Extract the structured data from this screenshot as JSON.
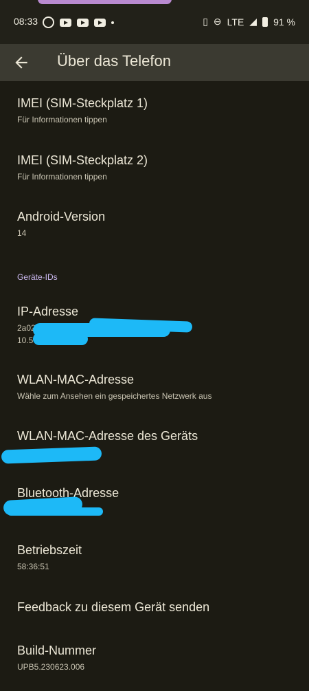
{
  "status_bar": {
    "time": "08:33",
    "network": "LTE",
    "battery": "91 %",
    "icons_left": [
      "whatsapp-icon",
      "youtube-icon",
      "youtube-icon",
      "youtube-icon",
      "dot-icon"
    ],
    "icons_right": [
      "vibrate-icon",
      "dnd-icon",
      "signal-icon",
      "battery-icon"
    ]
  },
  "app_bar": {
    "title": "Über das Telefon"
  },
  "items": [
    {
      "title": "IMEI (SIM-Steckplatz 1)",
      "subtitle": "Für Informationen tippen"
    },
    {
      "title": "IMEI (SIM-Steckplatz 2)",
      "subtitle": "Für Informationen tippen"
    },
    {
      "title": "Android-Version",
      "subtitle": "14"
    },
    {
      "section": "Geräte-IDs"
    },
    {
      "title": "IP-Adresse",
      "subtitle": "2a02",
      "subtitle2": "10.5"
    },
    {
      "title": "WLAN-MAC-Adresse",
      "subtitle": "Wähle zum Ansehen ein gespeichertes Netzwerk aus"
    },
    {
      "title": "WLAN-MAC-Adresse des Geräts",
      "subtitle": ""
    },
    {
      "title": "Bluetooth-Adresse",
      "subtitle": ""
    },
    {
      "title": "Betriebszeit",
      "subtitle": "58:36:51"
    },
    {
      "title": "Feedback zu diesem Gerät senden",
      "subtitle": ""
    },
    {
      "title": "Build-Nummer",
      "subtitle": "UPB5.230623.006"
    }
  ],
  "colors": {
    "background": "#1c1b13",
    "appbar": "#3b3a31",
    "accent_section": "#c9b7ee",
    "redaction": "#1db9f7"
  }
}
